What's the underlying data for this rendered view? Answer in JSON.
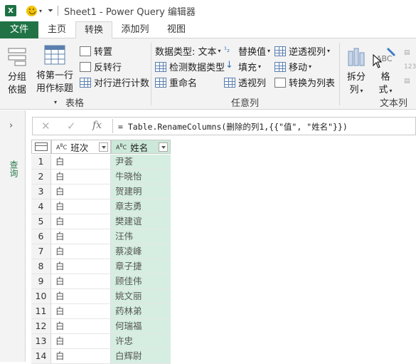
{
  "titlebar": {
    "app_icon": "X",
    "title": "Sheet1 - Power Query 编辑器"
  },
  "tabs": [
    "文件",
    "主页",
    "转换",
    "添加列",
    "视图"
  ],
  "active_tab": "转换",
  "ribbon": {
    "table_group": {
      "label": "表格",
      "group_by": [
        "分组",
        "依据"
      ],
      "first_row_header": [
        "将第一行",
        "用作标题"
      ],
      "transpose": "转置",
      "reverse_rows": "反转行",
      "count_rows": "对行进行计数"
    },
    "any_column_group": {
      "label": "任意列",
      "data_type": "数据类型: 文本",
      "detect_type": "检测数据类型",
      "rename": "重命名",
      "replace_values": "替换值",
      "fill": "填充",
      "pivot": "透视列",
      "unpivot": "逆透视列",
      "move": "移动",
      "to_list": "转换为列表"
    },
    "text_group": {
      "label": "文本列",
      "split": [
        "拆分",
        "列"
      ],
      "format": [
        "格",
        "式"
      ]
    }
  },
  "query_pane": {
    "label": "查询"
  },
  "formula_bar": {
    "fx": "fx",
    "formula": "= Table.RenameColumns(删除的列1,{{\"值\", \"姓名\"}})"
  },
  "columns": [
    "班次",
    "姓名"
  ],
  "rows": [
    {
      "n": "1",
      "shift": "白",
      "name": "尹荟"
    },
    {
      "n": "2",
      "shift": "白",
      "name": "牛晓怡"
    },
    {
      "n": "3",
      "shift": "白",
      "name": "贺建明"
    },
    {
      "n": "4",
      "shift": "白",
      "name": "章志勇"
    },
    {
      "n": "5",
      "shift": "白",
      "name": "樊建谊"
    },
    {
      "n": "6",
      "shift": "白",
      "name": "汪伟"
    },
    {
      "n": "7",
      "shift": "白",
      "name": "蔡凌峰"
    },
    {
      "n": "8",
      "shift": "白",
      "name": "章子捷"
    },
    {
      "n": "9",
      "shift": "白",
      "name": "顾佳伟"
    },
    {
      "n": "10",
      "shift": "白",
      "name": "姚文丽"
    },
    {
      "n": "11",
      "shift": "白",
      "name": "药林弟"
    },
    {
      "n": "12",
      "shift": "白",
      "name": "何瑞福"
    },
    {
      "n": "13",
      "shift": "白",
      "name": "许忠"
    },
    {
      "n": "14",
      "shift": "白",
      "name": "白辉尉"
    }
  ]
}
